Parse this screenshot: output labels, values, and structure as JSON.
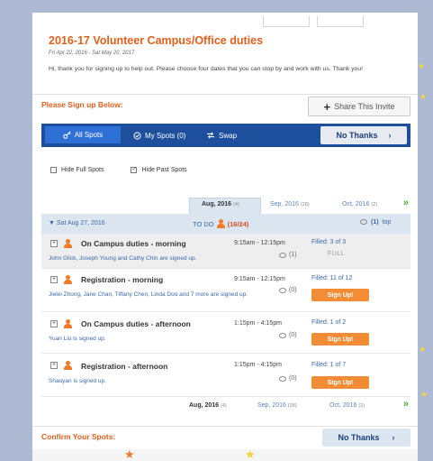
{
  "event": {
    "title": "2016-17 Volunteer Campus/Office duties",
    "dates": "Fri Apr 22, 2016 - Sat May 20, 2017",
    "message": "Hi, thank you for signing up to help out. Please choose four dates that you can stop by and work with us. Thank you!"
  },
  "signup": {
    "label": "Please Sign up Below:",
    "share_label": "Share This Invite"
  },
  "nav": {
    "all_spots": "All Spots",
    "my_spots": "My Spots (0)",
    "swap": "Swap",
    "no_thanks": "No Thanks"
  },
  "filters": {
    "hide_full": "Hide Full Spots",
    "hide_past": "Hide Past Spots",
    "hide_past_checked": true
  },
  "months": {
    "active": "Aug, 2016",
    "active_count": "(4)",
    "next": "Sep, 2016",
    "next_count": "(28)",
    "after": "Oct, 2016",
    "after_count": "(2)",
    "arrow": "»"
  },
  "day": {
    "date": "Sat Aug 27, 2016",
    "todo_label": "TO DO",
    "todo_count": "(16/24)",
    "comments": "(1)",
    "top_link": "top"
  },
  "slots": [
    {
      "name": "On Campus duties - morning",
      "time": "9:15am - 12:15pm",
      "comments": "(1)",
      "filled": "Filled: 3 of 3",
      "people": "John Glick, Joseph Young and Cathy Chin are signed up.",
      "status": "FULL"
    },
    {
      "name": "Registration - morning",
      "time": "9:15am - 12:15pm",
      "comments": "(0)",
      "filled": "Filled: 11 of 12",
      "people": "Jielei Zhong, Jane Chan, Tiffany Chen, Linda Doo and 7 more are signed up.",
      "button": "Sign Up!"
    },
    {
      "name": "On Campus duties - afternoon",
      "time": "1:15pm - 4:15pm",
      "comments": "(0)",
      "filled": "Filled: 1 of 2",
      "people": "Yuan Liu is signed up.",
      "button": "Sign Up!"
    },
    {
      "name": "Registration - afternoon",
      "time": "1:15pm - 4:15pm",
      "comments": "(0)",
      "filled": "Filled: 1 of 7",
      "people": "Shaoyan is signed up.",
      "button": "Sign Up!"
    }
  ],
  "confirm": {
    "label": "Confirm Your Spots:",
    "no_thanks": "No Thanks"
  },
  "colors": {
    "accent": "#e0601f",
    "nav_bg": "#1d4f9d",
    "signup_btn": "#f28d35",
    "link": "#3b68a8"
  }
}
